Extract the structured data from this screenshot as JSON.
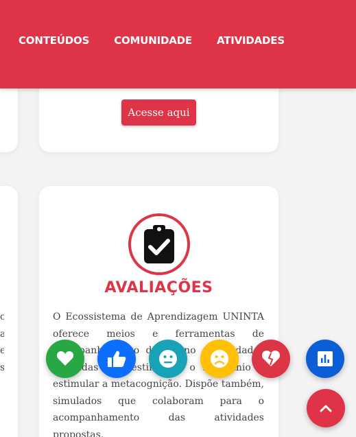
{
  "nav": {
    "items": [
      "CONTEÚDOS",
      "COMUNIDADE",
      "ATIVIDADES"
    ]
  },
  "cards": {
    "top": {
      "button_label": "Acesse aqui"
    },
    "evaluations": {
      "title": "AVALIAÇÕES",
      "description": "O Ecossistema de Aprendizagem UNINTA oferece meios e ferramentas de acompanhamento do ensino e atividades avaliadas que estimulam o raciocínio e estimular a metacognição. Dispõe também, simulados que colaboram para o acompanhamento das atividades propostas."
    },
    "left_fragment": [
      "o",
      "a",
      "e",
      "s"
    ]
  },
  "reactions": [
    {
      "name": "heart",
      "color": "#28a745"
    },
    {
      "name": "thumbs-up",
      "color": "#0d6efd"
    },
    {
      "name": "neutral-face",
      "color": "#17a2b8"
    },
    {
      "name": "sad-face",
      "color": "#ffc107"
    },
    {
      "name": "broken-heart",
      "color": "#dc3545"
    }
  ],
  "icons": {
    "chart": "bar-chart-icon",
    "scroll_top": "chevron-up-icon",
    "evaluation": "clipboard-check-icon"
  },
  "colors": {
    "brand_red": "#df3447",
    "background": "#f3f3f3"
  }
}
